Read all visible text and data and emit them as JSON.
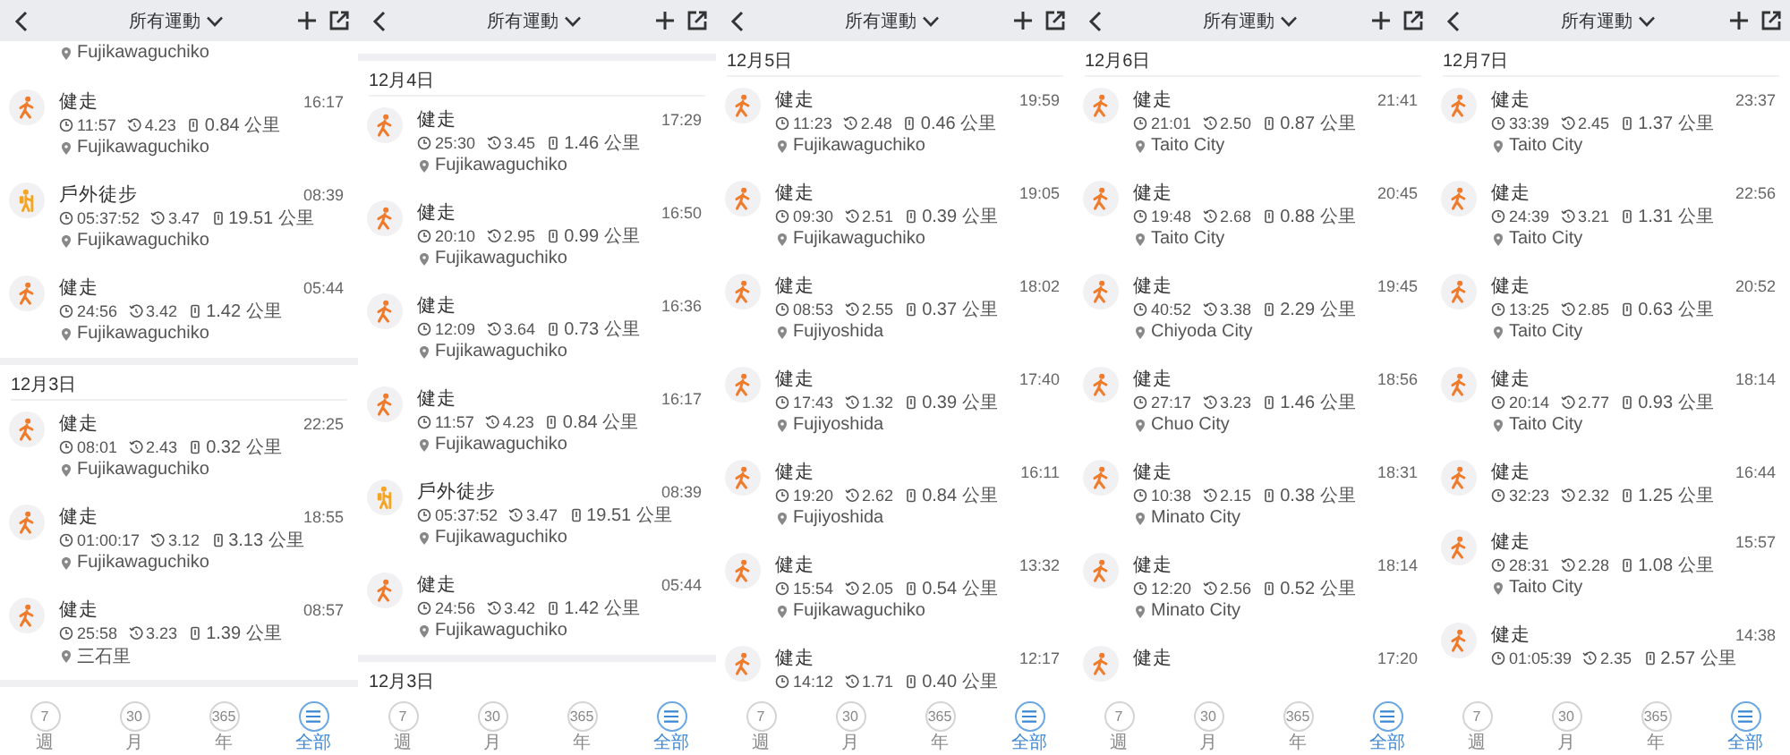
{
  "screens": [
    {
      "header": {
        "title": "所有運動"
      },
      "items": [
        {
          "kind": "tail",
          "location": "Fujikawaguchiko"
        },
        {
          "kind": "walk",
          "title": "健走",
          "time": "16:17",
          "duration": "11:57",
          "pace": "4.23",
          "distance": "0.84 公里",
          "location": "Fujikawaguchiko"
        },
        {
          "kind": "hike",
          "title": "戶外徒步",
          "time": "08:39",
          "duration": "05:37:52",
          "pace": "3.47",
          "distance": "19.51 公里",
          "location": "Fujikawaguchiko"
        },
        {
          "kind": "walk",
          "title": "健走",
          "time": "05:44",
          "duration": "24:56",
          "pace": "3.42",
          "distance": "1.42 公里",
          "location": "Fujikawaguchiko"
        },
        {
          "kind": "gap"
        },
        {
          "kind": "date",
          "label": "12月3日"
        },
        {
          "kind": "walk",
          "title": "健走",
          "time": "22:25",
          "duration": "08:01",
          "pace": "2.43",
          "distance": "0.32 公里",
          "location": "Fujikawaguchiko"
        },
        {
          "kind": "walk",
          "title": "健走",
          "time": "18:55",
          "duration": "01:00:17",
          "pace": "3.12",
          "distance": "3.13 公里",
          "location": "Fujikawaguchiko"
        },
        {
          "kind": "walk",
          "title": "健走",
          "time": "08:57",
          "duration": "25:58",
          "pace": "3.23",
          "distance": "1.39 公里",
          "location": "三石里"
        },
        {
          "kind": "gap"
        }
      ],
      "nav": [
        {
          "label": "週",
          "value": "7",
          "selected": false
        },
        {
          "label": "月",
          "value": "30",
          "selected": false
        },
        {
          "label": "年",
          "value": "365",
          "selected": false
        },
        {
          "label": "全部",
          "selected": true
        }
      ]
    },
    {
      "header": {
        "title": "所有運動"
      },
      "items": [
        {
          "kind": "blank"
        },
        {
          "kind": "gap"
        },
        {
          "kind": "date",
          "label": "12月4日"
        },
        {
          "kind": "walk",
          "title": "健走",
          "time": "17:29",
          "duration": "25:30",
          "pace": "3.45",
          "distance": "1.46 公里",
          "location": "Fujikawaguchiko"
        },
        {
          "kind": "walk",
          "title": "健走",
          "time": "16:50",
          "duration": "20:10",
          "pace": "2.95",
          "distance": "0.99 公里",
          "location": "Fujikawaguchiko"
        },
        {
          "kind": "walk",
          "title": "健走",
          "time": "16:36",
          "duration": "12:09",
          "pace": "3.64",
          "distance": "0.73 公里",
          "location": "Fujikawaguchiko"
        },
        {
          "kind": "walk",
          "title": "健走",
          "time": "16:17",
          "duration": "11:57",
          "pace": "4.23",
          "distance": "0.84 公里",
          "location": "Fujikawaguchiko"
        },
        {
          "kind": "hike",
          "title": "戶外徒步",
          "time": "08:39",
          "duration": "05:37:52",
          "pace": "3.47",
          "distance": "19.51 公里",
          "location": "Fujikawaguchiko"
        },
        {
          "kind": "walk",
          "title": "健走",
          "time": "05:44",
          "duration": "24:56",
          "pace": "3.42",
          "distance": "1.42 公里",
          "location": "Fujikawaguchiko"
        },
        {
          "kind": "gap"
        },
        {
          "kind": "date",
          "label": "12月3日"
        }
      ],
      "nav": [
        {
          "label": "週",
          "value": "7",
          "selected": false
        },
        {
          "label": "月",
          "value": "30",
          "selected": false
        },
        {
          "label": "年",
          "value": "365",
          "selected": false
        },
        {
          "label": "全部",
          "selected": true
        }
      ]
    },
    {
      "header": {
        "title": "所有運動"
      },
      "items": [
        {
          "kind": "date",
          "label": "12月5日"
        },
        {
          "kind": "walk",
          "title": "健走",
          "time": "19:59",
          "duration": "11:23",
          "pace": "2.48",
          "distance": "0.46 公里",
          "location": "Fujikawaguchiko"
        },
        {
          "kind": "walk",
          "title": "健走",
          "time": "19:05",
          "duration": "09:30",
          "pace": "2.51",
          "distance": "0.39 公里",
          "location": "Fujikawaguchiko"
        },
        {
          "kind": "walk",
          "title": "健走",
          "time": "18:02",
          "duration": "08:53",
          "pace": "2.55",
          "distance": "0.37 公里",
          "location": "Fujiyoshida"
        },
        {
          "kind": "walk",
          "title": "健走",
          "time": "17:40",
          "duration": "17:43",
          "pace": "1.32",
          "distance": "0.39 公里",
          "location": "Fujiyoshida"
        },
        {
          "kind": "walk",
          "title": "健走",
          "time": "16:11",
          "duration": "19:20",
          "pace": "2.62",
          "distance": "0.84 公里",
          "location": "Fujiyoshida"
        },
        {
          "kind": "walk",
          "title": "健走",
          "time": "13:32",
          "duration": "15:54",
          "pace": "2.05",
          "distance": "0.54 公里",
          "location": "Fujikawaguchiko"
        },
        {
          "kind": "walk",
          "title": "健走",
          "time": "12:17",
          "duration": "14:12",
          "pace": "1.71",
          "distance": "0.40 公里"
        }
      ],
      "nav": [
        {
          "label": "週",
          "value": "7",
          "selected": false
        },
        {
          "label": "月",
          "value": "30",
          "selected": false
        },
        {
          "label": "年",
          "value": "365",
          "selected": false
        },
        {
          "label": "全部",
          "selected": true
        }
      ]
    },
    {
      "header": {
        "title": "所有運動"
      },
      "items": [
        {
          "kind": "date",
          "label": "12月6日"
        },
        {
          "kind": "walk",
          "title": "健走",
          "time": "21:41",
          "duration": "21:01",
          "pace": "2.50",
          "distance": "0.87 公里",
          "location": "Taito City"
        },
        {
          "kind": "walk",
          "title": "健走",
          "time": "20:45",
          "duration": "19:48",
          "pace": "2.68",
          "distance": "0.88 公里",
          "location": "Taito City"
        },
        {
          "kind": "walk",
          "title": "健走",
          "time": "19:45",
          "duration": "40:52",
          "pace": "3.38",
          "distance": "2.29 公里",
          "location": "Chiyoda City"
        },
        {
          "kind": "walk",
          "title": "健走",
          "time": "18:56",
          "duration": "27:17",
          "pace": "3.23",
          "distance": "1.46 公里",
          "location": "Chuo City"
        },
        {
          "kind": "walk",
          "title": "健走",
          "time": "18:31",
          "duration": "10:38",
          "pace": "2.15",
          "distance": "0.38 公里",
          "location": "Minato City"
        },
        {
          "kind": "walk",
          "title": "健走",
          "time": "18:14",
          "duration": "12:20",
          "pace": "2.56",
          "distance": "0.52 公里",
          "location": "Minato City"
        },
        {
          "kind": "walk",
          "title": "健走",
          "time": "17:20"
        }
      ],
      "nav": [
        {
          "label": "週",
          "value": "7",
          "selected": false
        },
        {
          "label": "月",
          "value": "30",
          "selected": false
        },
        {
          "label": "年",
          "value": "365",
          "selected": false
        },
        {
          "label": "全部",
          "selected": true
        }
      ]
    },
    {
      "header": {
        "title": "所有運動"
      },
      "items": [
        {
          "kind": "date",
          "label": "12月7日"
        },
        {
          "kind": "walk",
          "title": "健走",
          "time": "23:37",
          "duration": "33:39",
          "pace": "2.45",
          "distance": "1.37 公里",
          "location": "Taito City"
        },
        {
          "kind": "walk",
          "title": "健走",
          "time": "22:56",
          "duration": "24:39",
          "pace": "3.21",
          "distance": "1.31 公里",
          "location": "Taito City"
        },
        {
          "kind": "walk",
          "title": "健走",
          "time": "20:52",
          "duration": "13:25",
          "pace": "2.85",
          "distance": "0.63 公里",
          "location": "Taito City"
        },
        {
          "kind": "walk",
          "title": "健走",
          "time": "18:14",
          "duration": "20:14",
          "pace": "2.77",
          "distance": "0.93 公里",
          "location": "Taito City"
        },
        {
          "kind": "walk",
          "title": "健走",
          "time": "16:44",
          "duration": "32:23",
          "pace": "2.32",
          "distance": "1.25 公里"
        },
        {
          "kind": "walk",
          "title": "健走",
          "time": "15:57",
          "duration": "28:31",
          "pace": "2.28",
          "distance": "1.08 公里",
          "location": "Taito City"
        },
        {
          "kind": "walk",
          "title": "健走",
          "time": "14:38",
          "duration": "01:05:39",
          "pace": "2.35",
          "distance": "2.57 公里"
        }
      ],
      "nav": [
        {
          "label": "週",
          "value": "7",
          "selected": false
        },
        {
          "label": "月",
          "value": "30",
          "selected": false
        },
        {
          "label": "年",
          "value": "365",
          "selected": false
        },
        {
          "label": "全部",
          "selected": true
        }
      ]
    }
  ]
}
